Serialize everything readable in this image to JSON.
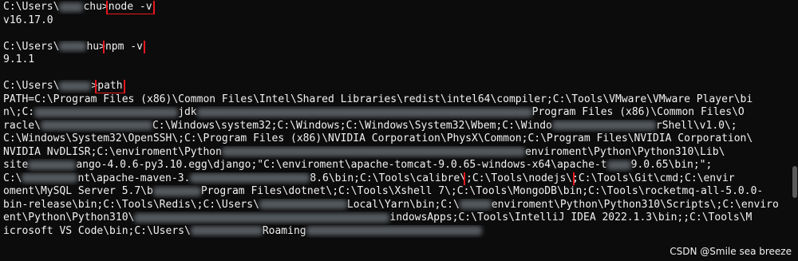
{
  "terminal": {
    "blocks": [
      {
        "prompt": "C:\\Users\\",
        "prompt_tail": "chu>",
        "command": "node -v",
        "output": "v16.17.0"
      },
      {
        "prompt": "C:\\Users\\",
        "prompt_tail": "hu>",
        "command": "npm -v",
        "output": "9.1.1"
      },
      {
        "prompt": "C:\\Users\\",
        "prompt_tail": ">",
        "command": "path",
        "output": ""
      }
    ],
    "path_lines": [
      "PATH=C:\\Program Files (x86)\\Common Files\\Intel\\Shared Libraries\\redist\\intel64\\compiler;C:\\Tools\\VMware\\VMware Player\\bi",
      "n\\;C:",
      "racle\\",
      "C:\\Windows\\System32\\OpenSSH\\;C:\\Program Files (x86)\\NVIDIA Corporation\\PhysX\\Common;C:\\Program Files\\NVIDIA Corporation\\",
      "NVIDIA NvDLISR;C:\\enviroment\\",
      "site",
      "C:\\",
      "oment\\MySQL Server 5.7\\b",
      "bin-release\\bin;C:\\Tools\\Redis\\;C:\\Users\\",
      "ent\\Python\\Python310\\",
      "icrosoft VS Code\\bin;C:\\Users\\"
    ],
    "path_fragments": {
      "l2a": "jdk",
      "l2b": "Program Files (x86)\\Common Files\\O",
      "l3a": "C:\\Windows\\system32;C:\\Windows;C:\\Windows\\System32\\Wbem;C:\\Windo",
      "l3b": "rShell\\v1.0\\;",
      "l5a": "Python",
      "l5b": "enviroment\\Python\\Python310\\Lib\\",
      "l6a": "ango-4.0.6-py3.10.egg\\django;\"C:\\enviroment\\apache-tomcat-9.0.65-windows-x64\\apache-t",
      "l6b": "9.0.65\\bin;\";",
      "l7a": "nt\\apache-maven-3.",
      "l7b": "8.6\\bin;C:\\Tools\\calibre\\",
      "l7hl": ";C:\\Tools\\nodejs\\",
      "l7c": ";C:\\Tools\\Git\\cmd;C:\\envir",
      "l8a": "Program Files\\dotnet\\;C:\\Tools\\Xshell 7\\;C:\\Tools\\MongoDB\\bin;C:\\Tools\\rocketmq-all-5.0.0-",
      "l9a": "Local\\Yarn\\bin;C:\\",
      "l9b": "enviroment\\Python\\Python310\\Scripts\\;C:\\enviro",
      "l10a": "indowsApps;C:\\Tools\\IntelliJ IDEA 2022.1.3\\bin;;C:\\Tools\\M",
      "l11a": "Roaming"
    }
  },
  "watermark": "CSDN @Smile sea breeze",
  "colors": {
    "background": "#0c0c0c",
    "text": "#f2f2f2",
    "highlight_box": "#e8171e"
  }
}
